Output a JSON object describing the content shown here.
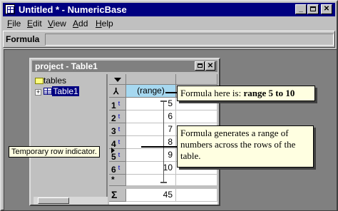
{
  "app": {
    "title": "Untitled * - NumericBase"
  },
  "menu": {
    "items": [
      "File",
      "Edit",
      "View",
      "Add",
      "Help"
    ],
    "underline": [
      "F",
      "E",
      "V",
      "A",
      "H"
    ]
  },
  "formula_bar": {
    "label": "Formula",
    "value": ""
  },
  "child_window": {
    "title": "project  - Table1"
  },
  "tree": {
    "root": "tables",
    "child": "Table1"
  },
  "grid": {
    "column_header": "(range)",
    "row_marker": "t",
    "rows": [
      {
        "num": "1",
        "value": "5"
      },
      {
        "num": "2",
        "value": "6"
      },
      {
        "num": "3",
        "value": "7"
      },
      {
        "num": "4",
        "value": "8"
      },
      {
        "num": "5",
        "value": "9"
      },
      {
        "num": "6",
        "value": "10"
      }
    ],
    "new_row": "*",
    "sum_label": "Σ",
    "sum_value": "45"
  },
  "callouts": {
    "formula_prefix": "Formula here is: ",
    "formula_bold": "range 5 to 10",
    "generates": "Formula generates a range of numbers across the rows of the table."
  },
  "tooltip": "Temporary row indicator.",
  "colors": {
    "title_active": "#000080",
    "title_inactive": "#808080",
    "header_highlight": "#a6d8f0",
    "callout_bg": "#ffffe1"
  }
}
